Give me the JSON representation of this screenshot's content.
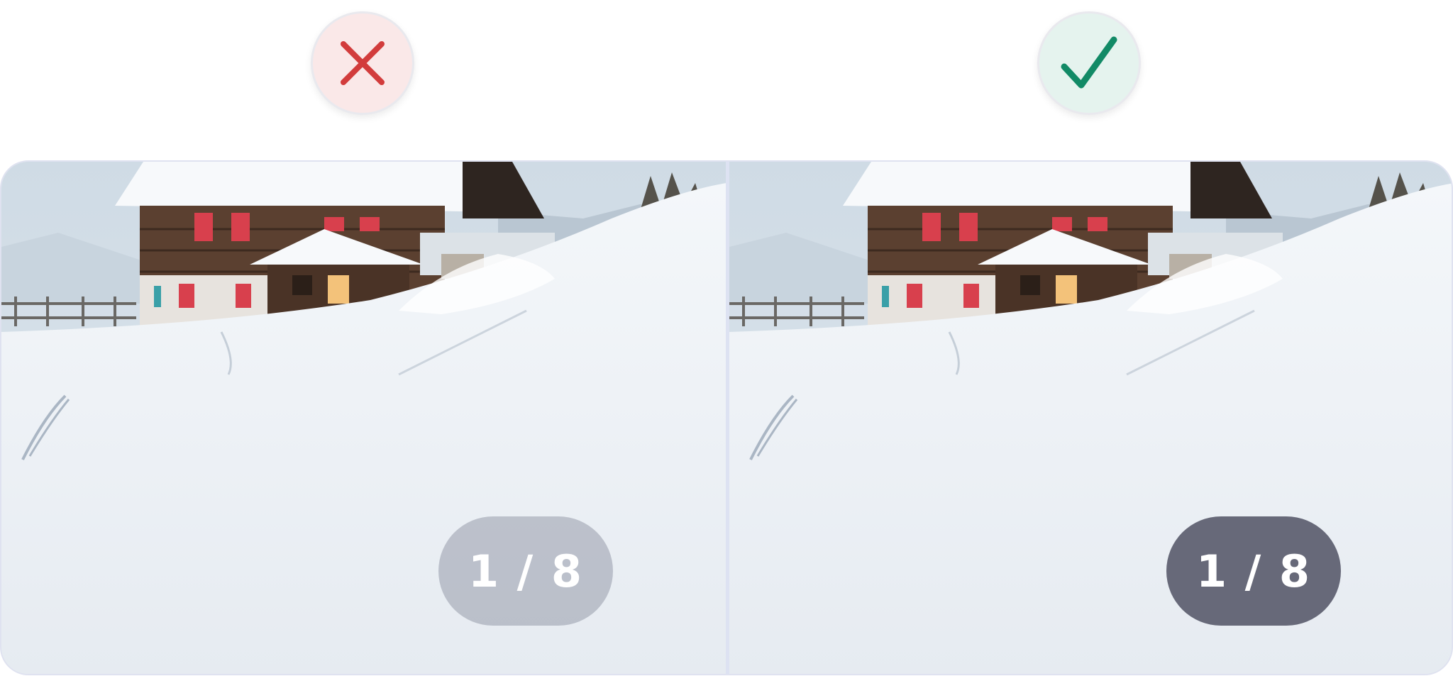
{
  "comparison": {
    "bad_example": {
      "icon": "x-mark-icon",
      "icon_color": "#d23c3c",
      "badge_bg": "#fae8e8",
      "counter_text": "1 / 8",
      "counter_bg": "rgba(150,155,170,0.55)"
    },
    "good_example": {
      "icon": "check-mark-icon",
      "icon_color": "#128a66",
      "badge_bg": "#e5f3ee",
      "counter_text": "1 / 8",
      "counter_bg": "#676979"
    }
  }
}
